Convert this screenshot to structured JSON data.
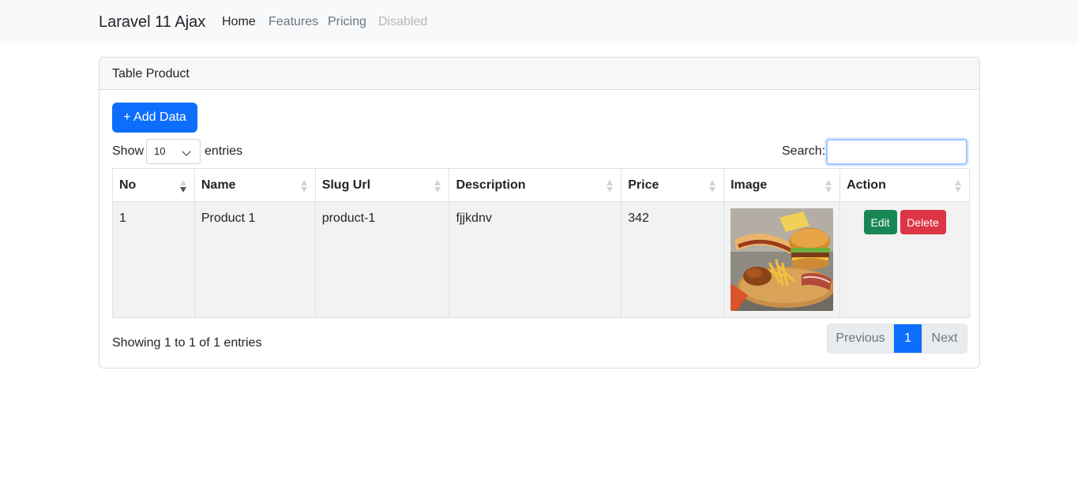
{
  "navbar": {
    "brand": "Laravel 11 Ajax",
    "links": [
      {
        "label": "Home"
      },
      {
        "label": "Features"
      },
      {
        "label": "Pricing"
      },
      {
        "label": "Disabled"
      }
    ]
  },
  "card": {
    "title": "Table Product",
    "add_button": "+ Add Data"
  },
  "table_controls": {
    "show_label": "Show",
    "page_length": "10",
    "entries_label": "entries",
    "search_label": "Search:",
    "search_value": ""
  },
  "table": {
    "columns": [
      "No",
      "Name",
      "Slug Url",
      "Description",
      "Price",
      "Image",
      "Action"
    ],
    "sorted_column": "No",
    "rows": [
      {
        "no": "1",
        "name": "Product 1",
        "slug": "product-1",
        "description": "fjjkdnv",
        "price": "342",
        "image": "burger-fries-food-photo",
        "edit_label": "Edit",
        "delete_label": "Delete"
      }
    ]
  },
  "footer": {
    "info": "Showing 1 to 1 of 1 entries",
    "pagination": {
      "previous": "Previous",
      "current": "1",
      "next": "Next"
    }
  },
  "colors": {
    "primary": "#0d6efd",
    "success": "#198754",
    "danger": "#dc3545",
    "navbar_bg": "#f8f9fa"
  }
}
